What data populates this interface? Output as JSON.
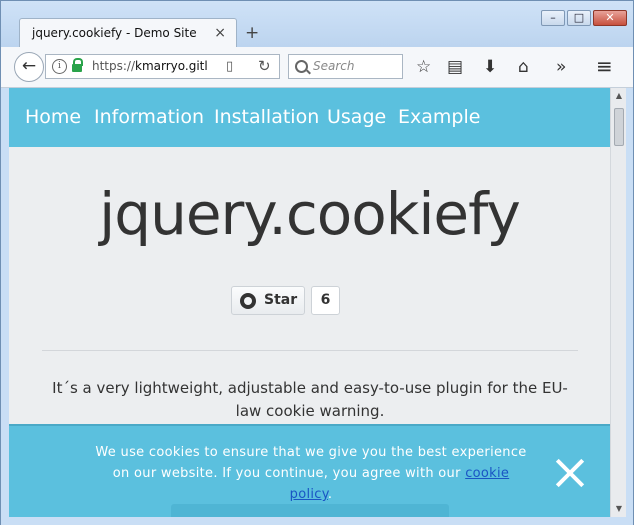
{
  "browser": {
    "tab_title": "jquery.cookiefy - Demo Site",
    "tab_close": "×",
    "new_tab": "+",
    "window_buttons": {
      "minimize": "–",
      "maximize": "□",
      "close": "✕"
    },
    "back_glyph": "←",
    "url_scheme": "https://",
    "url_host": "kmarryo.gitl",
    "reload_glyph": "↻",
    "reader_glyph": "▯",
    "search_placeholder": "Search",
    "toolbar_icons": [
      "star-icon",
      "library-icon",
      "download-icon",
      "home-icon",
      "overflow-icon",
      "menu-icon"
    ],
    "toolbar_glyphs": {
      "star": "☆",
      "library": "▤",
      "download": "⬇",
      "home": "⌂",
      "overflow": "»",
      "menu": "≡"
    }
  },
  "site": {
    "nav": [
      "Home",
      "Information",
      "Installation",
      "Usage",
      "Example"
    ],
    "title": "jquery.cookiefy",
    "github": {
      "star_label": "Star",
      "star_count": "6"
    },
    "lead": "It´s a very lightweight, adjustable and easy-to-use plugin for the EU-law cookie warning."
  },
  "cookie_banner": {
    "text_before_link": "We use cookies to ensure that we give you the best experience on our website. If you continue, you agree with our ",
    "link_text": "cookie policy",
    "text_after_link": "."
  },
  "colors": {
    "accent": "#5bc0de",
    "page_bg": "#eceef0",
    "link": "#1a55c4"
  }
}
